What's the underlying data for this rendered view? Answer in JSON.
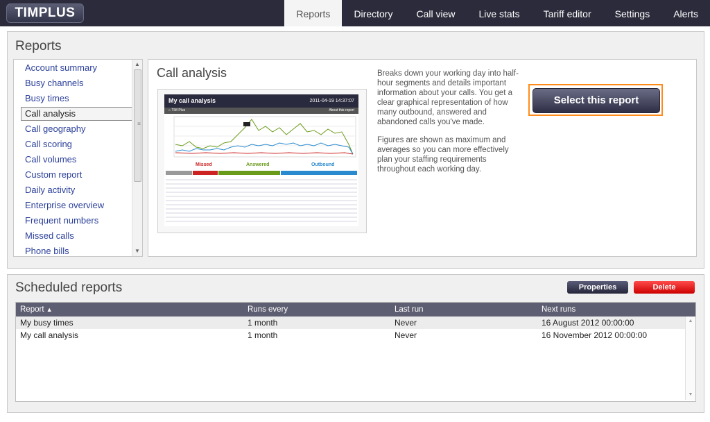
{
  "app": {
    "logo": "TIMPLUS"
  },
  "nav": [
    {
      "label": "Reports",
      "active": true
    },
    {
      "label": "Directory"
    },
    {
      "label": "Call view"
    },
    {
      "label": "Live stats"
    },
    {
      "label": "Tariff editor"
    },
    {
      "label": "Settings"
    },
    {
      "label": "Alerts"
    }
  ],
  "reports": {
    "title": "Reports",
    "list": [
      "Account summary",
      "Busy channels",
      "Busy times",
      "Call analysis",
      "Call geography",
      "Call scoring",
      "Call volumes",
      "Custom report",
      "Daily activity",
      "Enterprise overview",
      "Frequent numbers",
      "Missed calls",
      "Phone bills"
    ],
    "selected": "Call analysis",
    "detail": {
      "title": "Call analysis",
      "preview": {
        "header": "My call analysis",
        "date": "2011-04-19 14:37:07",
        "breadcrumb": "TIM Plus",
        "about": "About this report",
        "sections": [
          "Missed",
          "Answered",
          "Outbound"
        ],
        "colors": {
          "missed": "#cc2222",
          "answered": "#6a9a1a",
          "outbound": "#2a8ad0"
        }
      },
      "description": [
        "Breaks down your working day into half-hour segments and details important information about your calls. You get a clear graphical representation of how many outbound, answered and abandoned calls you've made.",
        "Figures are shown as maximum and averages so you can more effectively plan your staffing requirements throughout each working day."
      ],
      "select_button": "Select this report"
    }
  },
  "scheduled": {
    "title": "Scheduled reports",
    "properties_button": "Properties",
    "delete_button": "Delete",
    "columns": [
      "Report",
      "Runs every",
      "Last run",
      "Next runs"
    ],
    "sort_indicator": "▲",
    "rows": [
      {
        "report": "My busy times",
        "runs_every": "1 month",
        "last_run": "Never",
        "next_runs": "16 August 2012 00:00:00"
      },
      {
        "report": "My call analysis",
        "runs_every": "1 month",
        "last_run": "Never",
        "next_runs": "16 November 2012 00:00:00"
      }
    ]
  }
}
